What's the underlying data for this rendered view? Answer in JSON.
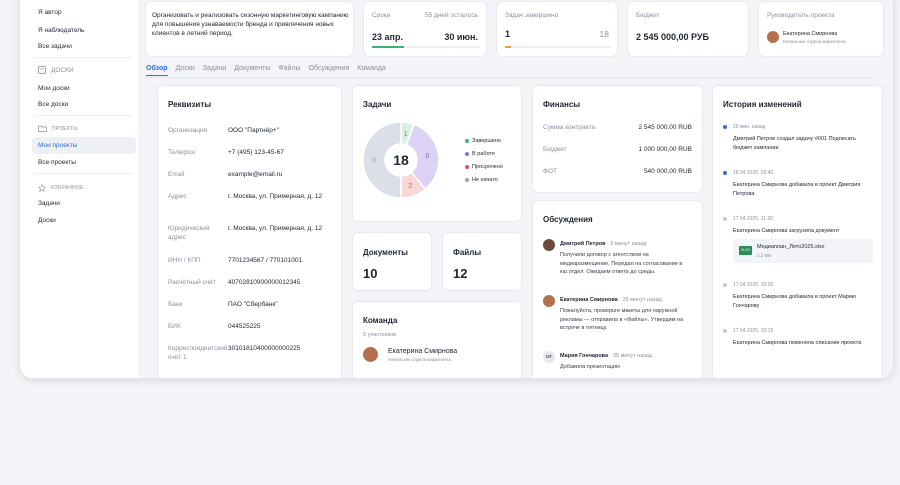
{
  "sidebar": {
    "top_items": [
      "Я автор",
      "Я наблюдатель",
      "Все задачи"
    ],
    "boards_section": "ДОСКИ",
    "boards_items": [
      "Мои доски",
      "Все доски"
    ],
    "projects_section": "ПРОЕКТЫ",
    "projects_items": [
      "Мои проекты",
      "Все проекты"
    ],
    "favorites_section": "ИЗБРАННОЕ",
    "favorites_items": [
      "Задачи",
      "Доски"
    ]
  },
  "summary": {
    "description": "Организовать и реализовать сезонную маркетинговую кампанию для повышения узнаваемости бренда и привлечения новых клиентов в летний период.",
    "terms_label": "Сроки",
    "days_left": "55 дней осталось",
    "start": "23 апр.",
    "end": "30 июн.",
    "terms_progress": 0.3,
    "tasks_label": "Задач завершено",
    "tasks_done": "1",
    "tasks_total": "18",
    "tasks_progress": 0.06,
    "budget_label": "Бюджет",
    "budget_value": "2 545 000,00 РУБ",
    "manager_label": "Руководитель проекта",
    "manager_name": "Екатерина Смирнова",
    "manager_role": "Начальник отдела маркетинга"
  },
  "tabs": [
    "Обзор",
    "Доски",
    "Задачи",
    "Документы",
    "Файлы",
    "Обсуждения",
    "Команда"
  ],
  "requisites": {
    "title": "Реквизиты",
    "rows": [
      {
        "k": "Организация",
        "v": "ООО \"Партнёр+\""
      },
      {
        "k": "Телефон",
        "v": "+7 (495) 123-45-67"
      },
      {
        "k": "Email",
        "v": "example@email.ru"
      },
      {
        "k": "Адрес",
        "v": "г. Москва, ул. Примерная, д. 12"
      },
      {
        "k": "Юридический адрес",
        "v": "г. Москва, ул. Примерная, д. 12"
      },
      {
        "k": "ИНН / КПП",
        "v": "7701234567 / 770101001"
      },
      {
        "k": "Расчётный счёт",
        "v": "40702810900000012345"
      },
      {
        "k": "Банк",
        "v": "ПАО \"Сбербанк\""
      },
      {
        "k": "БИК",
        "v": "044525225"
      },
      {
        "k": "Корреспондентский счёт 1",
        "v": "30101810400000000225"
      }
    ]
  },
  "tasks": {
    "title": "Задачи",
    "total": "18",
    "colors": {
      "done": "#3cb371",
      "in_work": "#8e6fd8",
      "overdue": "#e2504f",
      "not_started": "#9aa2b6"
    },
    "chart_data": {
      "type": "pie",
      "categories": [
        "Завершено",
        "В работе",
        "Просрочено",
        "Не начато"
      ],
      "values": [
        1,
        6,
        2,
        9
      ]
    }
  },
  "documents": {
    "title": "Документы",
    "count": "10"
  },
  "files": {
    "title": "Файлы",
    "count": "12"
  },
  "team": {
    "title": "Команда",
    "count_label": "5 участников",
    "member_name": "Екатерина Смирнова",
    "member_role": "Начальник отдела маркетинга"
  },
  "finance": {
    "title": "Финансы",
    "rows": [
      {
        "k": "Сумма контракта",
        "v": "2 545 000,00 RUB"
      },
      {
        "k": "Бюджет",
        "v": "1 000 000,00 RUB"
      },
      {
        "k": "ФОТ",
        "v": "540 000,00 RUB"
      }
    ]
  },
  "discussions": {
    "title": "Обсуждения",
    "items": [
      {
        "author": "Дмитрий Петров",
        "time": "· 5 минут назад",
        "text": "Получили договор с агентством на медиаразмещение. Передал на согласование в юр.отдел. Ожидаем ответа до среды."
      },
      {
        "author": "Екатерина Смирнова",
        "time": "· 25 минут назад",
        "text": "Пожалуйста, проверьте макеты для наружной рекламы — отправила в «Файлы». Утвердим на встрече в пятницу."
      },
      {
        "author": "Мария Гончарова",
        "time": "· 35 минут назад",
        "initials": "МГ",
        "text": "Добавила презентацию"
      }
    ]
  },
  "history": {
    "title": "История изменений",
    "items": [
      {
        "time": "20 мин. назад",
        "text": "Дмитрий Петров создал задачу #001 Подписать бюджет кампании"
      },
      {
        "time": "18.04.2025, 09:40",
        "text": "Екатерина Смирнова добавила в проект Дмитрия Петрова"
      },
      {
        "time": "17.04.2025, 11:20",
        "text": "Екатерина Смирнова загрузила документ"
      },
      {
        "time": "17.04.2025, 10:20",
        "text": "Екатерина Смирнова добавила в проект Марию Гончарову"
      },
      {
        "time": "17.04.2025, 10:15",
        "text": "Екатерина Смирнова поменяла описание проекта"
      }
    ],
    "file": {
      "badge": "XLSX",
      "name": "Медиаплан_Лето2025.xlsx",
      "size": "2.2 MB"
    }
  }
}
